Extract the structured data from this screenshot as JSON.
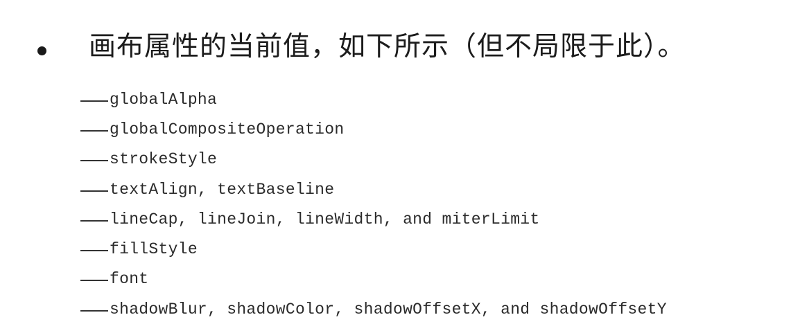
{
  "heading": "画布属性的当前值，如下所示（但不局限于此）。",
  "items": [
    "globalAlpha",
    "globalCompositeOperation",
    "strokeStyle",
    "textAlign, textBaseline",
    "lineCap, lineJoin, lineWidth, and miterLimit",
    "fillStyle",
    "font",
    "shadowBlur, shadowColor, shadowOffsetX, and shadowOffsetY"
  ]
}
